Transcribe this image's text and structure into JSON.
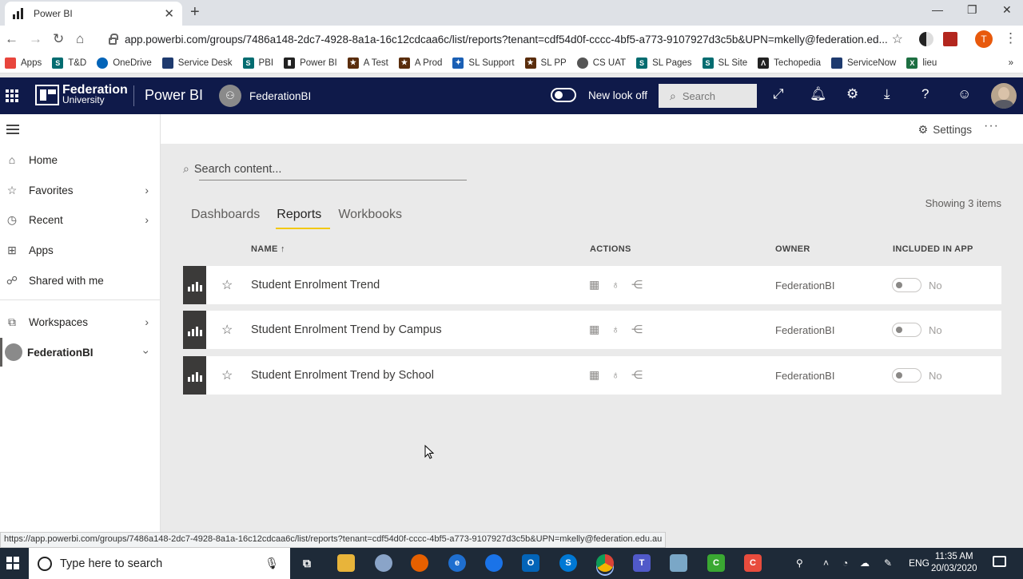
{
  "browser": {
    "tab_title": "Power BI",
    "url": "app.powerbi.com/groups/7486a148-2dc7-4928-8a1a-16c12cdcaa6c/list/reports?tenant=cdf54d0f-cccc-4bf5-a773-9107927d3c5b&UPN=mkelly@federation.ed...",
    "profile_initial": "T",
    "status_url": "https://app.powerbi.com/groups/7486a148-2dc7-4928-8a1a-16c12cdcaa6c/list/reports?tenant=cdf54d0f-cccc-4bf5-a773-9107927d3c5b&UPN=mkelly@federation.edu.au"
  },
  "bookmarks": [
    {
      "label": "Apps",
      "icon": "apps-grid-icon",
      "color": "#e8453c"
    },
    {
      "label": "T&D",
      "icon": "sharepoint-icon",
      "color": "#036c70"
    },
    {
      "label": "OneDrive",
      "icon": "onedrive-icon",
      "color": "#0364b8"
    },
    {
      "label": "Service Desk",
      "icon": "servicedesk-icon",
      "color": "#1e3a6e"
    },
    {
      "label": "PBI",
      "icon": "sharepoint-icon",
      "color": "#036c70"
    },
    {
      "label": "Power BI",
      "icon": "powerbi-icon",
      "color": "#222222"
    },
    {
      "label": "A Test",
      "icon": "star-badge-icon",
      "color": "#5a2d0c"
    },
    {
      "label": "A Prod",
      "icon": "star-badge-icon",
      "color": "#5a2d0c"
    },
    {
      "label": "SL Support",
      "icon": "support-icon",
      "color": "#1a5fb4"
    },
    {
      "label": "SL PP",
      "icon": "star-badge-icon",
      "color": "#5a2d0c"
    },
    {
      "label": "CS UAT",
      "icon": "globe-icon",
      "color": "#555555"
    },
    {
      "label": "SL Pages",
      "icon": "sharepoint-icon",
      "color": "#036c70"
    },
    {
      "label": "SL Site",
      "icon": "sharepoint-icon",
      "color": "#036c70"
    },
    {
      "label": "Techopedia",
      "icon": "techopedia-icon",
      "color": "#222222"
    },
    {
      "label": "ServiceNow",
      "icon": "servicenow-icon",
      "color": "#1e3a6e"
    },
    {
      "label": "lieu",
      "icon": "excel-icon",
      "color": "#1d6f42"
    }
  ],
  "header": {
    "logo_line1": "Federation",
    "logo_line2": "University",
    "product": "Power BI",
    "workspace": "FederationBI",
    "toggle_label": "New look off",
    "search_placeholder": "Search",
    "bg_color": "#0f1a4a"
  },
  "nav": {
    "items": [
      {
        "label": "Home",
        "icon": "home-icon"
      },
      {
        "label": "Favorites",
        "icon": "star-icon"
      },
      {
        "label": "Recent",
        "icon": "clock-icon"
      },
      {
        "label": "Apps",
        "icon": "apps-icon"
      },
      {
        "label": "Shared with me",
        "icon": "shared-icon"
      },
      {
        "label": "Workspaces",
        "icon": "workspaces-icon"
      },
      {
        "label": "FederationBI",
        "icon": "workspace-avatar-icon"
      }
    ]
  },
  "toolbar": {
    "settings_label": "Settings",
    "more_label": "···"
  },
  "content": {
    "search_placeholder": "Search content...",
    "showing": "Showing 3 items",
    "tabs": [
      "Dashboards",
      "Reports",
      "Workbooks"
    ],
    "active_tab": "Reports",
    "columns": {
      "name": "NAME",
      "actions": "ACTIONS",
      "owner": "OWNER",
      "included": "INCLUDED IN APP"
    },
    "rows": [
      {
        "name": "Student Enrolment Trend",
        "owner": "FederationBI",
        "included": "No"
      },
      {
        "name": "Student Enrolment Trend by Campus",
        "owner": "FederationBI",
        "included": "No"
      },
      {
        "name": "Student Enrolment Trend by School",
        "owner": "FederationBI",
        "included": "No"
      }
    ],
    "accent_color": "#f2c811"
  },
  "taskbar": {
    "search_placeholder": "Type here to search",
    "language": "ENG",
    "time": "11:35 AM",
    "date": "20/03/2020"
  }
}
